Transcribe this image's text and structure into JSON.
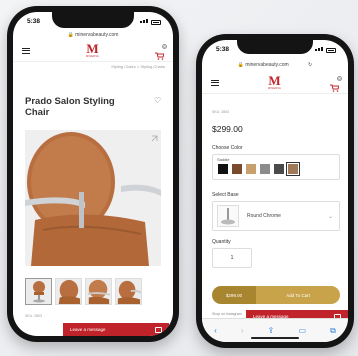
{
  "phone1": {
    "status_time": "5:38",
    "url": "minervabeauty.com",
    "breadcrumb": "Styling Chairs > Styling Chairs",
    "logo_text": "M",
    "logo_sub": "MINERVA",
    "cart_count": "0",
    "product_title": "Prado Salon Styling Chair",
    "sku": "SKU: 2803",
    "chat_label": "Leave a message"
  },
  "phone2": {
    "status_time": "5:38",
    "url": "minervabeauty.com",
    "logo_text": "M",
    "logo_sub": "MINERVA",
    "cart_count": "0",
    "sku": "SKU: 2803",
    "price": "$299.00",
    "choose_color_label": "Choose Color",
    "finish_label": "Saddle",
    "swatches": [
      "#111111",
      "#7a4a2c",
      "#c8a06e",
      "#8c8c8c",
      "#4a4a4a",
      "#a07a58"
    ],
    "selected_swatch": 5,
    "select_base_label": "Select Base",
    "base_name": "Round Chrome",
    "quantity_label": "Quantity",
    "quantity_value": "1",
    "cart_price": "$299.00",
    "add_to_cart_label": "Add To Cart",
    "footnote": "Shop on Instagram",
    "chat_label": "Leave a message"
  },
  "colors": {
    "brand_red": "#c0242a",
    "gold": "#c9a34a",
    "gold_dark": "#a8862f",
    "leather": "#b86e3f"
  }
}
